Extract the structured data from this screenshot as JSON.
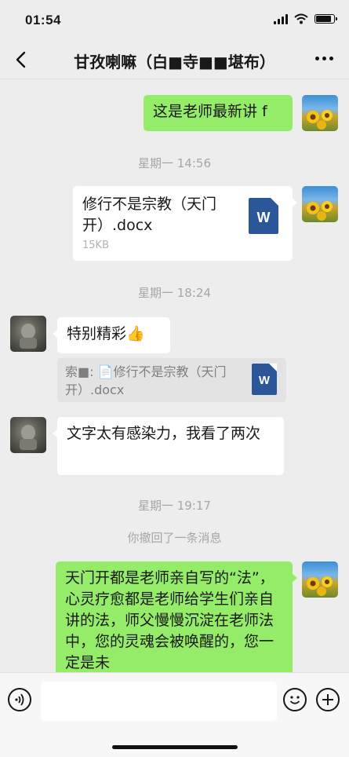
{
  "status_bar": {
    "time": "01:54",
    "battery_level": 0.85
  },
  "nav": {
    "title": "甘孜喇嘛（白■寺■■堪布）"
  },
  "messages": {
    "m1": {
      "text": "这是老师最新讲 f"
    },
    "t1": "星期一 14:56",
    "file1": {
      "name": "修行不是宗教（天门开）.docx",
      "size": "15KB",
      "icon": "W"
    },
    "t2": "星期一 18:24",
    "m2": {
      "text": "特别精彩👍"
    },
    "quote": {
      "text": "索■: 📄修行不是宗教（天门开）.docx",
      "icon": "W"
    },
    "m3": {
      "text": "文字太有感染力，我看了两次"
    },
    "t3": "星期一 19:17",
    "recall": "你撤回了一条消息",
    "m4": {
      "text": "天门开都是老师亲自写的“法”，心灵疗愈都是老师给学生们亲自讲的法，师父慢慢沉淀在老师法中，您的灵魂会被唤醒的，您一定是未"
    }
  },
  "input": {
    "placeholder": ""
  },
  "colors": {
    "sent_bubble": "#95ec69",
    "received_bubble": "#ffffff",
    "background": "#ededed",
    "word_blue": "#2b579a"
  }
}
